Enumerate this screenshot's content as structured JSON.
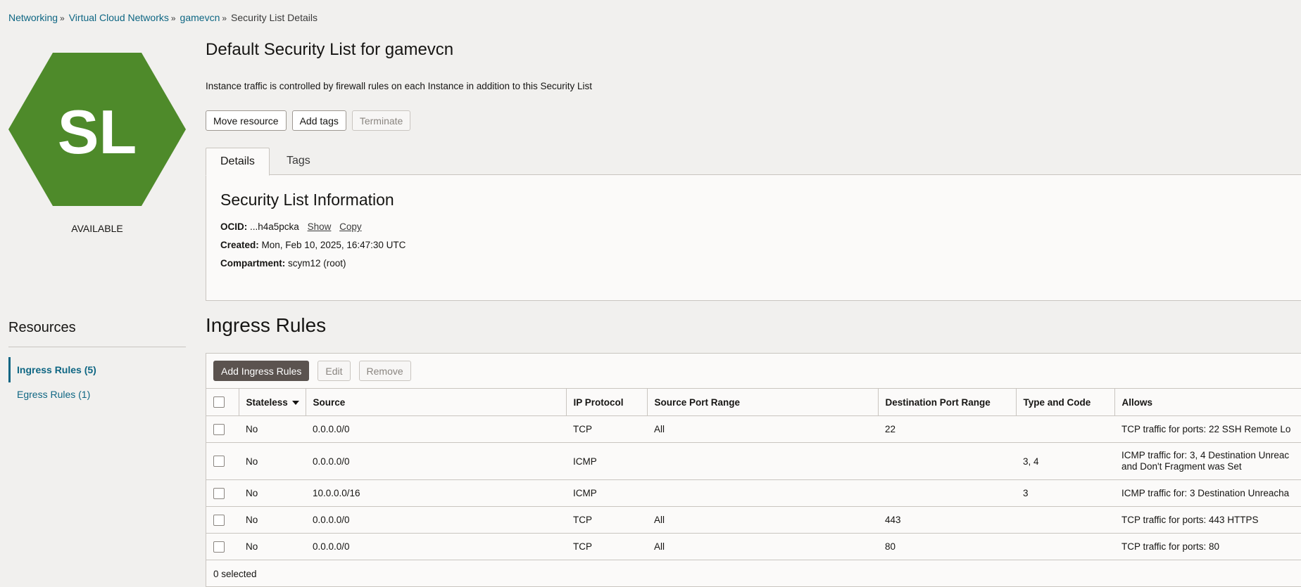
{
  "breadcrumb": {
    "items": [
      "Networking",
      "Virtual Cloud Networks",
      "gamevcn"
    ],
    "current": "Security List Details"
  },
  "resource_icon": {
    "initials": "SL",
    "color": "#4e8a2a"
  },
  "status": "AVAILABLE",
  "header": {
    "title": "Default Security List for gamevcn",
    "description": "Instance traffic is controlled by firewall rules on each Instance in addition to this Security List"
  },
  "actions": {
    "move_resource": "Move resource",
    "add_tags": "Add tags",
    "terminate": "Terminate"
  },
  "tabs": {
    "details": "Details",
    "tags": "Tags"
  },
  "info": {
    "title": "Security List Information",
    "ocid_label": "OCID:",
    "ocid_value": "...h4a5pcka",
    "show": "Show",
    "copy": "Copy",
    "created_label": "Created:",
    "created_value": "Mon, Feb 10, 2025, 16:47:30 UTC",
    "compartment_label": "Compartment:",
    "compartment_value": "scym12 (root)"
  },
  "resources": {
    "title": "Resources",
    "items": [
      "Ingress Rules (5)",
      "Egress Rules (1)"
    ]
  },
  "ingress": {
    "title": "Ingress Rules",
    "add_button": "Add Ingress Rules",
    "edit_button": "Edit",
    "remove_button": "Remove",
    "columns": [
      "Stateless",
      "Source",
      "IP Protocol",
      "Source Port Range",
      "Destination Port Range",
      "Type and Code",
      "Allows"
    ],
    "rows": [
      {
        "stateless": "No",
        "source": "0.0.0.0/0",
        "protocol": "TCP",
        "source_port": "All",
        "dest_port": "22",
        "type_code": "",
        "allows": "TCP traffic for ports: 22 SSH Remote Lo"
      },
      {
        "stateless": "No",
        "source": "0.0.0.0/0",
        "protocol": "ICMP",
        "source_port": "",
        "dest_port": "",
        "type_code": "3, 4",
        "allows": "ICMP traffic for: 3, 4 Destination Unreac\nand Don't Fragment was Set"
      },
      {
        "stateless": "No",
        "source": "10.0.0.0/16",
        "protocol": "ICMP",
        "source_port": "",
        "dest_port": "",
        "type_code": "3",
        "allows": "ICMP traffic for: 3 Destination Unreacha"
      },
      {
        "stateless": "No",
        "source": "0.0.0.0/0",
        "protocol": "TCP",
        "source_port": "All",
        "dest_port": "443",
        "type_code": "",
        "allows": "TCP traffic for ports: 443 HTTPS"
      },
      {
        "stateless": "No",
        "source": "0.0.0.0/0",
        "protocol": "TCP",
        "source_port": "All",
        "dest_port": "80",
        "type_code": "",
        "allows": "TCP traffic for ports: 80"
      }
    ],
    "selected_count": "0 selected"
  }
}
